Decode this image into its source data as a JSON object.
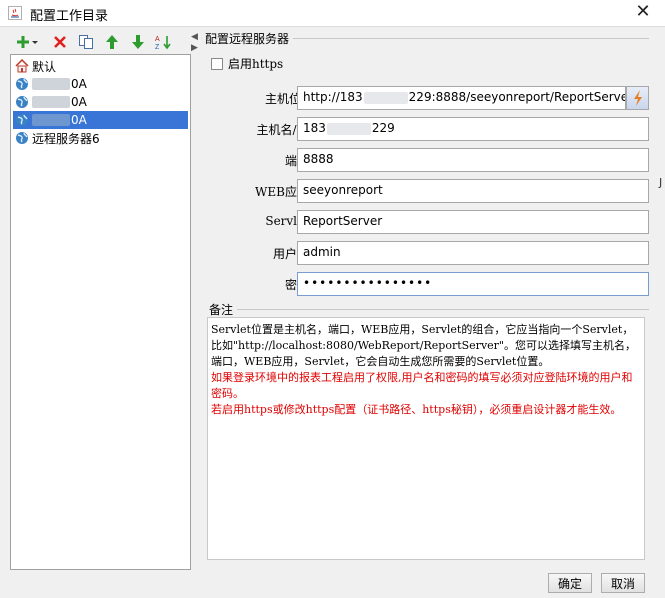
{
  "window": {
    "title": "配置工作目录"
  },
  "tree": {
    "items": [
      {
        "label": "默认",
        "blurred": false,
        "selected": false
      },
      {
        "label": "0A",
        "blurred": true,
        "selected": false
      },
      {
        "label": "0A",
        "blurred": true,
        "selected": false
      },
      {
        "label": "0A",
        "blurred": true,
        "selected": true
      },
      {
        "label": "远程服务器6",
        "blurred": false,
        "selected": false
      }
    ]
  },
  "form": {
    "group_title": "配置远程服务器",
    "https_label": "启用https",
    "host_url_label": "主机位置",
    "host_url_prefix": "http://183",
    "host_url_suffix": "229:8888/seeyonreport/ReportServer",
    "host_ip_label": "主机名/IP:",
    "host_ip_prefix": "183",
    "host_ip_suffix": "229",
    "port_label": "端口:",
    "port_value": "8888",
    "webapp_label": "WEB应用:",
    "webapp_value": "seeyonreport",
    "servlet_label": "Servlet:",
    "servlet_value": "ReportServer",
    "user_label": "用户名:",
    "user_value": "admin",
    "password_label": "密码:",
    "password_value": "••••••••••••••••"
  },
  "remark": {
    "title": "备注",
    "black_text": "Servlet位置是主机名，端口，WEB应用，Servlet的组合，它应当指向一个Servlet，比如\"http://localhost:8080/WebReport/ReportServer\"。您可以选择填写主机名，端口，WEB应用，Servlet，它会自动生成您所需要的Servlet位置。",
    "red_text_1": "如果登录环境中的报表工程启用了权限,用户名和密码的填写必须对应登陆环境的用户和密码。",
    "red_text_2": "若启用https或修改https配置（证书路径、https秘钥），必须重启设计器才能生效。"
  },
  "buttons": {
    "ok": "确定",
    "cancel": "取消"
  },
  "colors": {
    "selection": "#3875d7",
    "warning": "#e00000",
    "add": "#2e9b2e",
    "delete": "#e02020"
  }
}
